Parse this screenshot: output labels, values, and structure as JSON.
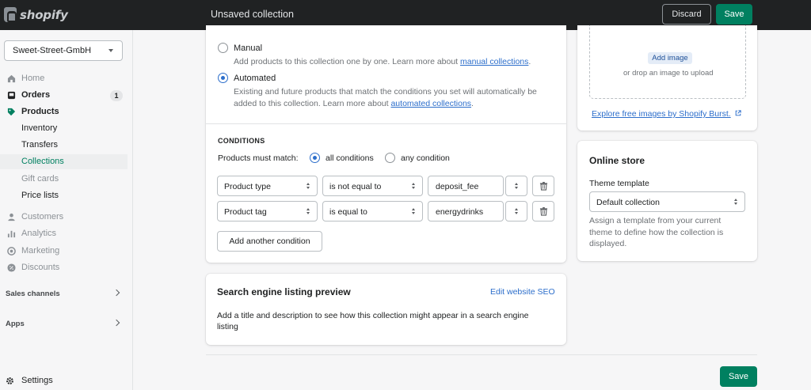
{
  "topbar": {
    "brand": "shopify",
    "title": "Unsaved collection",
    "discard_label": "Discard",
    "save_label": "Save"
  },
  "sidebar": {
    "store_name": "Sweet-Street-GmbH",
    "items": [
      {
        "label": "Home",
        "icon": "home-icon"
      },
      {
        "label": "Orders",
        "icon": "orders-icon",
        "badge": "1"
      },
      {
        "label": "Products",
        "icon": "tag-icon"
      },
      {
        "label": "Inventory"
      },
      {
        "label": "Transfers"
      },
      {
        "label": "Collections"
      },
      {
        "label": "Gift cards"
      },
      {
        "label": "Price lists"
      },
      {
        "label": "Customers",
        "icon": "person-icon"
      },
      {
        "label": "Analytics",
        "icon": "bar-chart-icon"
      },
      {
        "label": "Marketing",
        "icon": "target-icon"
      },
      {
        "label": "Discounts",
        "icon": "discount-icon"
      }
    ],
    "sales_channels": "Sales channels",
    "apps": "Apps",
    "settings": "Settings"
  },
  "collection_type": {
    "manual_label": "Manual",
    "manual_help_prefix": "Add products to this collection one by one. Learn more about ",
    "manual_help_link": "manual collections",
    "manual_help_suffix": ".",
    "automated_label": "Automated",
    "automated_help_line1": "Existing and future products that match the conditions you set will automatically be",
    "automated_help_line2_prefix": "added to this collection. Learn more about ",
    "automated_help_link": "automated collections",
    "automated_help_suffix": ".",
    "selected": "Automated"
  },
  "conditions": {
    "heading": "CONDITIONS",
    "must_match_label": "Products must match:",
    "all_label": "all conditions",
    "any_label": "any condition",
    "match_mode": "all conditions",
    "rows": [
      {
        "field": "Product type",
        "operator": "is not equal to",
        "value": "deposit_fee"
      },
      {
        "field": "Product tag",
        "operator": "is equal to",
        "value": "energydrinks"
      }
    ],
    "add_button": "Add another condition"
  },
  "seo": {
    "title": "Search engine listing preview",
    "edit_link": "Edit website SEO",
    "description_line1": "Add a title and description to see how this collection might appear in a search engine",
    "description_line2": "listing"
  },
  "image": {
    "add_image": "Add image",
    "drop_hint": "or drop an image to upload",
    "burst_link": "Explore free images by Shopify Burst."
  },
  "online_store": {
    "title": "Online store",
    "theme_template_label": "Theme template",
    "theme_template_value": "Default collection",
    "help_line1": "Assign a template from your current",
    "help_line2": "theme to define how the collection is",
    "help_line3": "displayed."
  },
  "footer": {
    "save_label": "Save"
  },
  "colors": {
    "topbar": "#202223",
    "primary": "#008060",
    "link": "#2c6ecb",
    "background": "#f6f6f7"
  }
}
